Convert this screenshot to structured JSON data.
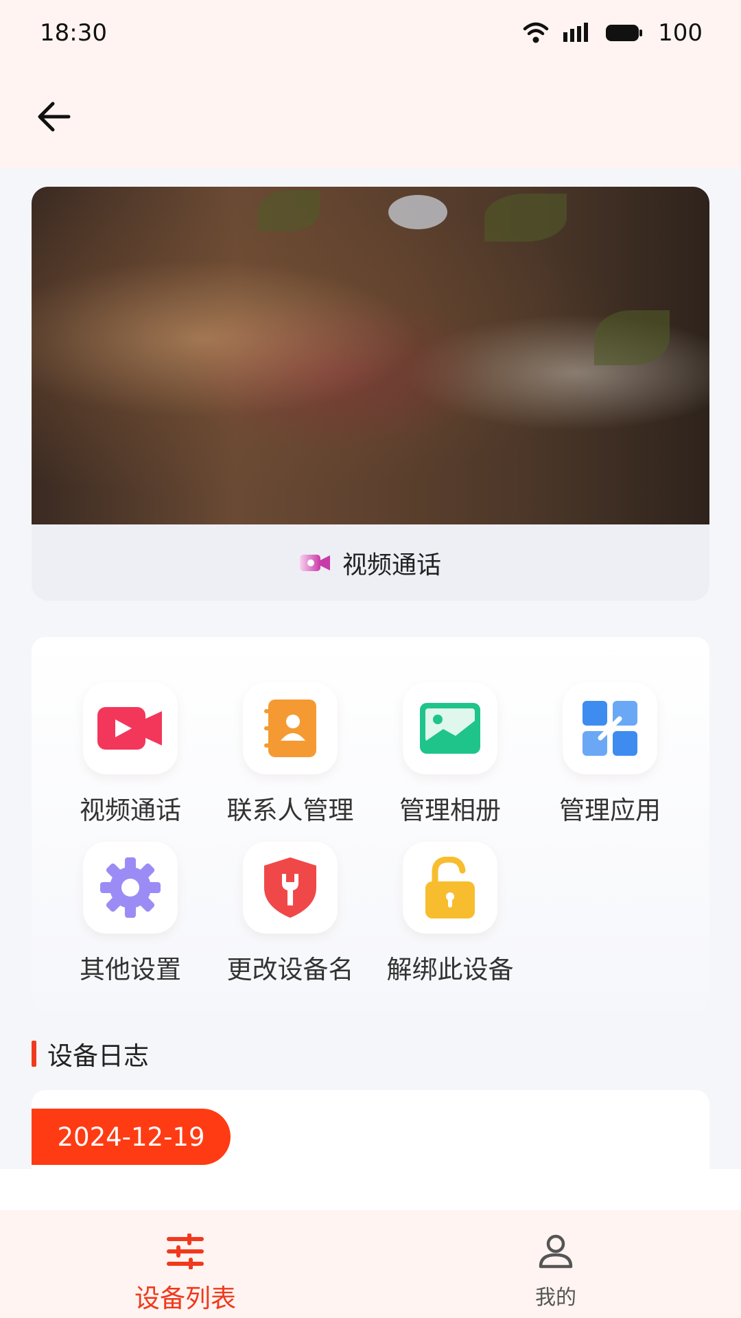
{
  "status_bar": {
    "time": "18:30",
    "battery": "100",
    "icons": [
      "wifi-icon",
      "signal-icon",
      "battery-icon"
    ]
  },
  "nav": {
    "back_icon": "back-arrow-icon"
  },
  "video_card": {
    "call_label": "视频通话",
    "call_icon": "video-camera-icon"
  },
  "functions": {
    "items": [
      {
        "label": "视频通话",
        "icon": "video-call-icon",
        "color": "#f2375a"
      },
      {
        "label": "联系人管理",
        "icon": "contacts-book-icon",
        "color": "#f59a32"
      },
      {
        "label": "管理相册",
        "icon": "photo-album-icon",
        "color": "#1fc48a"
      },
      {
        "label": "管理应用",
        "icon": "app-manage-icon",
        "color": "#3f8cf0"
      },
      {
        "label": "其他设置",
        "icon": "gear-icon",
        "color": "#9b8cf5"
      },
      {
        "label": "更改设备名",
        "icon": "wrench-shield-icon",
        "color": "#f04848"
      },
      {
        "label": "解绑此设备",
        "icon": "unlock-icon",
        "color": "#f8bd2e"
      }
    ]
  },
  "log": {
    "title": "设备日志",
    "date": "2024-12-19",
    "accent": "#ff3b14"
  },
  "tabs": [
    {
      "label": "设备列表",
      "icon": "sliders-icon",
      "active": true
    },
    {
      "label": "我的",
      "icon": "person-icon",
      "active": false
    }
  ]
}
